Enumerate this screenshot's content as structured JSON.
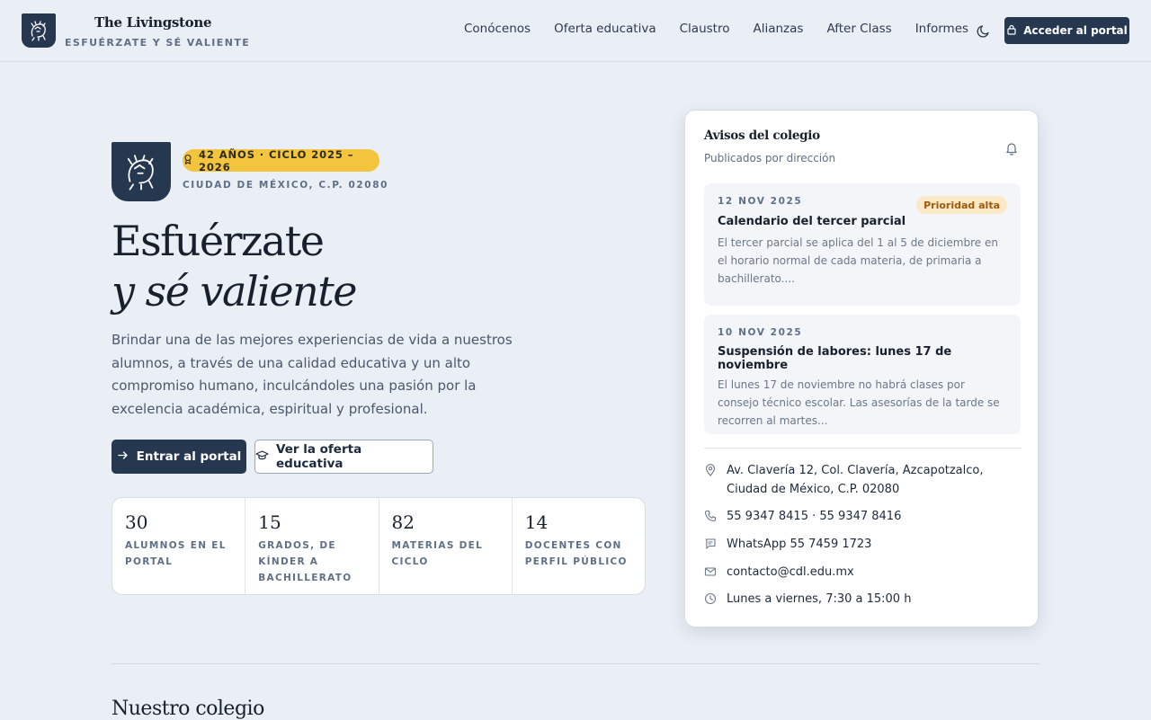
{
  "header": {
    "brand_name": "The Livingstone",
    "motto": "ESFUÉRZATE Y SÉ VALIENTE",
    "nav": [
      "Conócenos",
      "Oferta educativa",
      "Claustro",
      "Alianzas",
      "After Class",
      "Informes"
    ],
    "portal_button": "Acceder al portal"
  },
  "hero": {
    "badge": "42 AÑOS · CICLO 2025 – 2026",
    "location": "CIUDAD DE MÉXICO, C.P. 02080",
    "title_line1": "Esfuérzate",
    "title_line2": "y sé valiente",
    "lead": "Brindar una de las mejores experiencias de vida a nuestros alumnos, a través de una calidad educativa y un alto compromiso humano, inculcándoles una pasión por la excelencia académica, espiritual y profesional.",
    "primary_button": "Entrar al portal",
    "secondary_button": "Ver la oferta educativa",
    "stats": [
      {
        "value": "30",
        "label": "Alumnos en el portal"
      },
      {
        "value": "15",
        "label": "Grados, de kínder a bachillerato"
      },
      {
        "value": "82",
        "label": "Materias del ciclo"
      },
      {
        "value": "14",
        "label": "Docentes con perfil público"
      }
    ]
  },
  "notices": {
    "title": "Avisos del colegio",
    "subtitle": "Publicados por dirección",
    "items": [
      {
        "date": "12 NOV 2025",
        "priority": "Prioridad alta",
        "title": "Calendario del tercer parcial",
        "body": "El tercer parcial se aplica del 1 al 5 de diciembre en el horario normal de cada materia, de primaria a bachillerato...."
      },
      {
        "date": "10 NOV 2025",
        "title": "Suspensión de labores: lunes 17 de noviembre",
        "body": "El lunes 17 de noviembre no habrá clases por consejo técnico escolar. Las asesorías de la tarde se recorren al martes..."
      }
    ],
    "contact": {
      "address": "Av. Clavería 12, Col. Clavería, Azcapotzalco, Ciudad de México, C.P. 02080",
      "phone": "55 9347 8415 · 55 9347 8416",
      "whatsapp": "WhatsApp 55 7459 1723",
      "email": "contacto@cdl.edu.mx",
      "hours": "Lunes a viernes, 7:30 a 15:00 h"
    }
  },
  "section": {
    "title": "Nuestro colegio"
  },
  "colors": {
    "navy": "#26384f",
    "gold": "#f3c53f",
    "background": "#eaeef5",
    "priority_bg": "#fce8c5",
    "priority_text": "#9a5b0f"
  },
  "icons": {
    "logo": "lion-crest-icon",
    "theme_toggle": "moon-icon",
    "portal": "lock-icon",
    "badge": "award-ribbon-icon",
    "primary_button": "arrow-right-icon",
    "secondary_button": "graduation-cap-icon",
    "notices": "bell-icon",
    "address": "map-pin-icon",
    "phone": "phone-icon",
    "whatsapp": "chat-icon",
    "email": "mail-icon",
    "hours": "clock-icon"
  }
}
